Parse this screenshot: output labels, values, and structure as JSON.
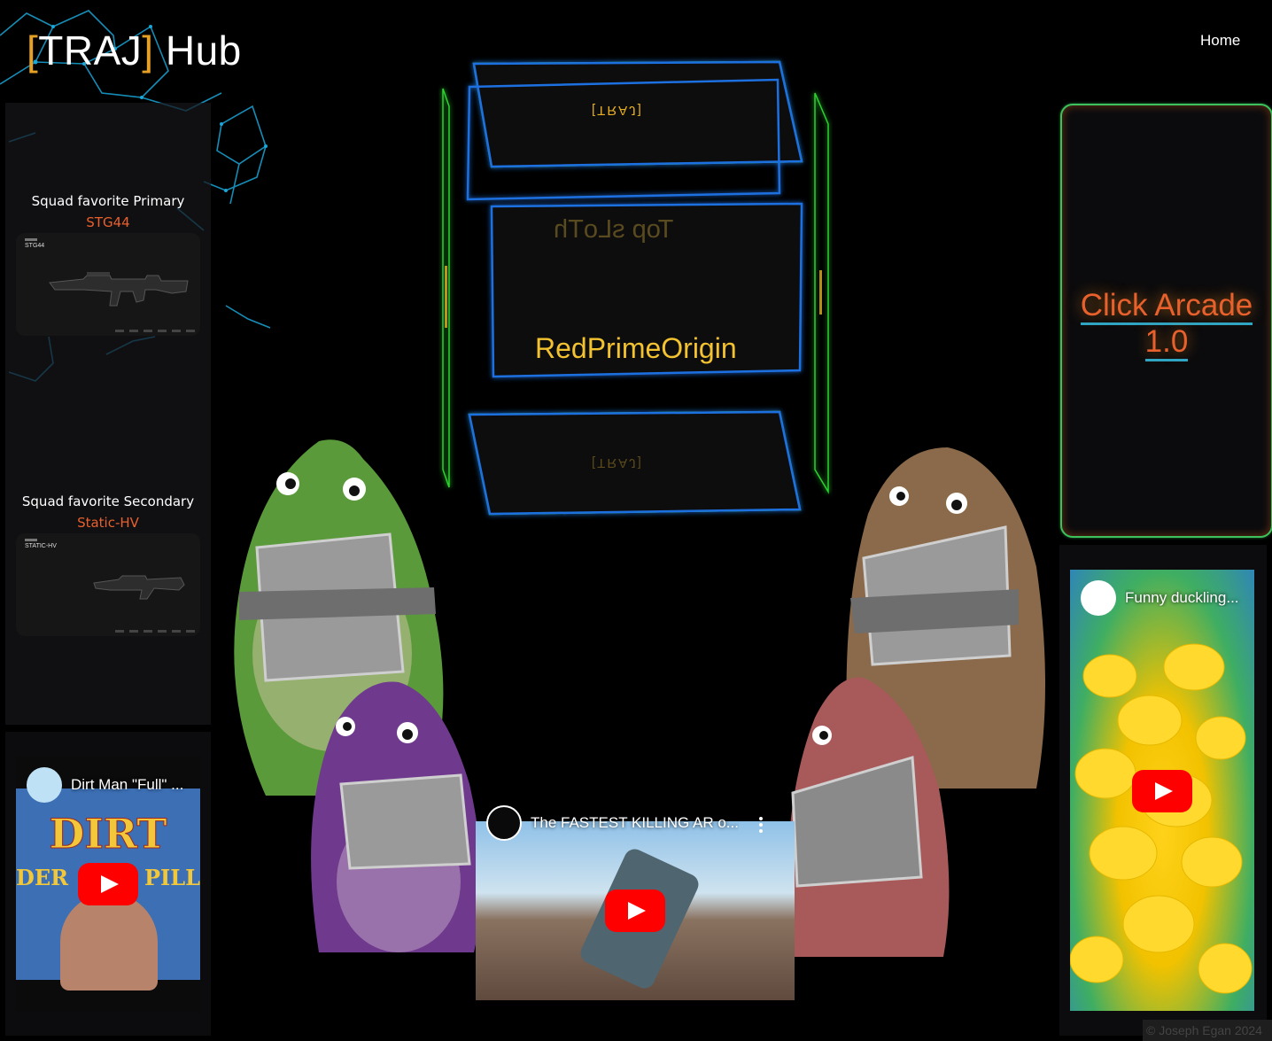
{
  "header": {
    "logo_open": "[",
    "logo_brand": "TRAJ",
    "logo_close": "]",
    "logo_suffix": " Hub",
    "nav_home": "Home"
  },
  "loadout": {
    "primary_label": "Squad favorite Primary",
    "primary_name": "STG44",
    "primary_tag": "STG44",
    "secondary_label": "Squad favorite Secondary",
    "secondary_name": "Static-HV",
    "secondary_tag": "STATIC-HV"
  },
  "cube": {
    "top_brand": "[TRAJ]",
    "back_title": "Top sLoTh",
    "front_name": "RedPrimeOrigin",
    "bottom_brand": "[TRAJ]"
  },
  "arcade": {
    "line1": "Click Arcade",
    "line2": "1.0"
  },
  "videos": {
    "left": {
      "title": "Dirt Man \"Full\" ...",
      "thumb_text_1": "DIRT",
      "thumb_text_2_left": "DER",
      "thumb_text_2_right": "PILL"
    },
    "center": {
      "title": "The FASTEST KILLING AR o..."
    },
    "right": {
      "title": "Funny duckling..."
    }
  },
  "footer": {
    "text": "© Joseph Egan 2024"
  },
  "colors": {
    "accent_orange": "#e8602c",
    "logo_bracket": "#e6a025",
    "cube_gold": "#f3c230",
    "arcade_border": "#3cc25c",
    "link_underline": "#2aa7c9",
    "youtube_red": "#ff0000"
  },
  "icons": {
    "play": "youtube-play-icon",
    "menu": "more-vert-icon",
    "network": "network-lines-decoration"
  }
}
